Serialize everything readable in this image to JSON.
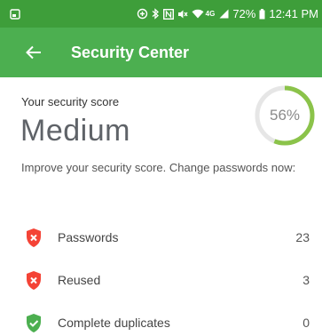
{
  "status_bar": {
    "battery_text": "72%",
    "time": "12:41 PM",
    "network_label": "4G",
    "icons": [
      "notification-icon",
      "data-saver-icon",
      "bluetooth-icon",
      "nfc-icon",
      "mute-icon",
      "wifi-icon",
      "signal-icon",
      "battery-icon"
    ]
  },
  "app_bar": {
    "title": "Security Center",
    "back_icon": "arrow-back-icon",
    "color": "#4caf50",
    "status_color": "#3e9e3a"
  },
  "score": {
    "label": "Your security score",
    "level": "Medium",
    "percent_text": "56%",
    "percent_value": 56,
    "gauge_color": "#8bc34a",
    "track_color": "#e6e6e6"
  },
  "improve_text": "Improve your security score. Change passwords now:",
  "stats": [
    {
      "label": "Passwords",
      "count": "23",
      "status": "bad",
      "icon": "shield-x-icon",
      "color": "#f44336"
    },
    {
      "label": "Reused",
      "count": "3",
      "status": "bad",
      "icon": "shield-x-icon",
      "color": "#f44336"
    },
    {
      "label": "Complete duplicates",
      "count": "0",
      "status": "good",
      "icon": "shield-check-icon",
      "color": "#4caf50"
    }
  ]
}
